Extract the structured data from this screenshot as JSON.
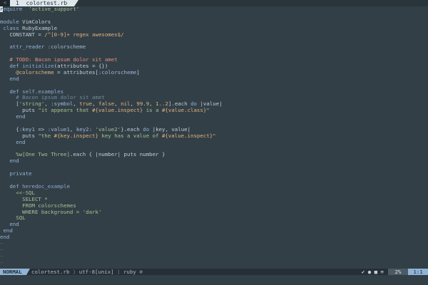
{
  "tabline": {
    "separator": "<",
    "tab_label": "1  colortest.rb"
  },
  "code": [
    {
      "parts": [
        [
          "cursor",
          "r"
        ],
        [
          "kw",
          "equire"
        ],
        [
          "",
          "  "
        ],
        [
          "str",
          "'active_support'"
        ]
      ]
    },
    {
      "parts": []
    },
    {
      "parts": [
        [
          "kw",
          "module"
        ],
        [
          "",
          " "
        ],
        [
          "const",
          "VimColors"
        ]
      ]
    },
    {
      "parts": [
        [
          "",
          " "
        ],
        [
          "kw",
          "class"
        ],
        [
          "",
          " "
        ],
        [
          "const",
          "RubyExample"
        ]
      ]
    },
    {
      "parts": [
        [
          "",
          "   CONSTANT = "
        ],
        [
          "regex",
          "/^[0-9]+ regex awesomes$/"
        ]
      ]
    },
    {
      "parts": []
    },
    {
      "parts": [
        [
          "",
          "   "
        ],
        [
          "kw",
          "attr_reader"
        ],
        [
          "",
          " "
        ],
        [
          "sym",
          ":colorscheme"
        ]
      ]
    },
    {
      "parts": []
    },
    {
      "parts": [
        [
          "",
          "   "
        ],
        [
          "todo",
          "# TODO: Bacon ipsum dolor sit amet"
        ]
      ]
    },
    {
      "parts": [
        [
          "",
          "   "
        ],
        [
          "kw",
          "def"
        ],
        [
          "",
          " "
        ],
        [
          "fn",
          "initialize"
        ],
        [
          "",
          "(attributes = {})"
        ]
      ]
    },
    {
      "parts": [
        [
          "",
          "     "
        ],
        [
          "ivar",
          "@colorscheme"
        ],
        [
          "",
          " = attributes["
        ],
        [
          "sym",
          ":colorscheme"
        ],
        [
          "",
          "]"
        ]
      ]
    },
    {
      "parts": [
        [
          "",
          "   "
        ],
        [
          "kw",
          "end"
        ]
      ]
    },
    {
      "parts": []
    },
    {
      "parts": [
        [
          "",
          "   "
        ],
        [
          "kw",
          "def"
        ],
        [
          "",
          " "
        ],
        [
          "fn",
          "self.examples"
        ]
      ]
    },
    {
      "parts": [
        [
          "",
          "     "
        ],
        [
          "cmt",
          "# Bacon ipsum dolor sit amet"
        ]
      ]
    },
    {
      "parts": [
        [
          "",
          "     ["
        ],
        [
          "str",
          "'string'"
        ],
        [
          "",
          ", "
        ],
        [
          "sym",
          ":symbol"
        ],
        [
          "",
          ", "
        ],
        [
          "num",
          "true"
        ],
        [
          "",
          ", "
        ],
        [
          "num",
          "false"
        ],
        [
          "",
          ", "
        ],
        [
          "num",
          "nil"
        ],
        [
          "",
          ", "
        ],
        [
          "num",
          "99.9"
        ],
        [
          "",
          ", "
        ],
        [
          "num",
          "1..2"
        ],
        [
          "",
          "].each "
        ],
        [
          "kw",
          "do"
        ],
        [
          "",
          " |value|"
        ]
      ]
    },
    {
      "parts": [
        [
          "",
          "       puts "
        ],
        [
          "str",
          "\"it appears that "
        ],
        [
          "interp",
          "#{value.inspect}"
        ],
        [
          "str",
          " is a "
        ],
        [
          "interp",
          "#{value.class}"
        ],
        [
          "str",
          "\""
        ]
      ]
    },
    {
      "parts": [
        [
          "",
          "     "
        ],
        [
          "kw",
          "end"
        ]
      ]
    },
    {
      "parts": []
    },
    {
      "parts": [
        [
          "",
          "     {"
        ],
        [
          "sym",
          ":key1"
        ],
        [
          "",
          " => "
        ],
        [
          "sym",
          ":value1"
        ],
        [
          "",
          ", "
        ],
        [
          "sym",
          "key2:"
        ],
        [
          "",
          " "
        ],
        [
          "str",
          "'value2'"
        ],
        [
          "",
          "}.each "
        ],
        [
          "kw",
          "do"
        ],
        [
          "",
          " |key, value|"
        ]
      ]
    },
    {
      "parts": [
        [
          "",
          "       puts "
        ],
        [
          "str",
          "\"the "
        ],
        [
          "interp",
          "#{key.inspect}"
        ],
        [
          "str",
          " key has a value of "
        ],
        [
          "interp",
          "#{value.inspect}"
        ],
        [
          "str",
          "\""
        ]
      ]
    },
    {
      "parts": [
        [
          "",
          "     "
        ],
        [
          "kw",
          "end"
        ]
      ]
    },
    {
      "parts": []
    },
    {
      "parts": [
        [
          "",
          "     "
        ],
        [
          "str",
          "%w[One Two Three]"
        ],
        [
          "",
          ".each { |number| puts number }"
        ]
      ]
    },
    {
      "parts": [
        [
          "",
          "   "
        ],
        [
          "kw",
          "end"
        ]
      ]
    },
    {
      "parts": []
    },
    {
      "parts": [
        [
          "",
          "   "
        ],
        [
          "kw",
          "private"
        ]
      ]
    },
    {
      "parts": []
    },
    {
      "parts": [
        [
          "",
          "   "
        ],
        [
          "kw",
          "def"
        ],
        [
          "",
          " "
        ],
        [
          "fn",
          "heredoc_example"
        ]
      ]
    },
    {
      "parts": [
        [
          "",
          "     "
        ],
        [
          "str",
          "<<-SQL"
        ]
      ]
    },
    {
      "parts": [
        [
          "",
          "       "
        ],
        [
          "str",
          "SELECT *"
        ]
      ]
    },
    {
      "parts": [
        [
          "",
          "       "
        ],
        [
          "str",
          "FROM colorschemes"
        ]
      ]
    },
    {
      "parts": [
        [
          "",
          "       "
        ],
        [
          "str",
          "WHERE background = 'dark'"
        ]
      ]
    },
    {
      "parts": [
        [
          "",
          "     "
        ],
        [
          "str",
          "SQL"
        ]
      ]
    },
    {
      "parts": [
        [
          "",
          "   "
        ],
        [
          "kw",
          "end"
        ]
      ]
    },
    {
      "parts": [
        [
          "",
          " "
        ],
        [
          "kw",
          "end"
        ]
      ]
    },
    {
      "parts": [
        [
          "kw",
          "end"
        ]
      ]
    }
  ],
  "empty_line_marker": "~",
  "empty_line_count": 4,
  "statusline": {
    "mode": "NORMAL",
    "filename": "colortest.rb",
    "encoding": "utf-8[unix]",
    "filetype": "ruby",
    "percent": "2%",
    "position": "1:1"
  },
  "colors": {
    "background": "#333f47",
    "accent": "#8fb3d6",
    "string": "#a7c18f"
  }
}
